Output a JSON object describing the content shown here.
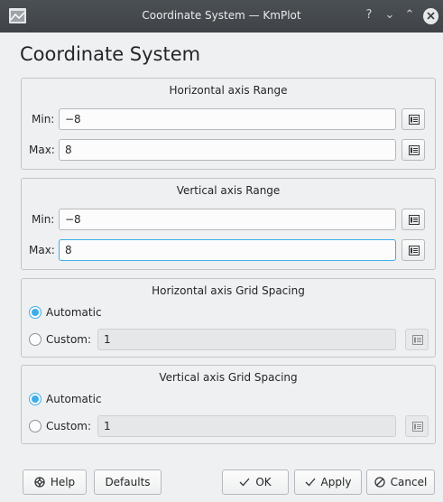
{
  "window": {
    "title": "Coordinate System — KmPlot",
    "controls": {
      "help": "?",
      "minimize": "⌄",
      "maximize": "⌃",
      "close": "✕"
    }
  },
  "page_title": "Coordinate System",
  "horizontal_range": {
    "title": "Horizontal axis Range",
    "min_label": "Min:",
    "min_value": "−8",
    "max_label": "Max:",
    "max_value": "8"
  },
  "vertical_range": {
    "title": "Vertical axis Range",
    "min_label": "Min:",
    "min_value": "−8",
    "max_label": "Max:",
    "max_value": "8"
  },
  "horizontal_grid": {
    "title": "Horizontal axis Grid Spacing",
    "automatic_label": "Automatic",
    "custom_label": "Custom:",
    "custom_value": "1",
    "selected": "automatic"
  },
  "vertical_grid": {
    "title": "Vertical axis Grid Spacing",
    "automatic_label": "Automatic",
    "custom_label": "Custom:",
    "custom_value": "1",
    "selected": "automatic"
  },
  "buttons": {
    "help": "Help",
    "defaults": "Defaults",
    "ok": "OK",
    "apply": "Apply",
    "cancel": "Cancel"
  },
  "colors": {
    "accent": "#3daee9",
    "titlebar": "#44484c",
    "window_bg": "#eff0f1"
  },
  "icons": {
    "app": "kmplot-icon",
    "field_picker": "edit-expression-icon",
    "help": "help-icon",
    "ok": "checkmark-icon",
    "apply": "checkmark-icon",
    "cancel": "cancel-icon"
  }
}
